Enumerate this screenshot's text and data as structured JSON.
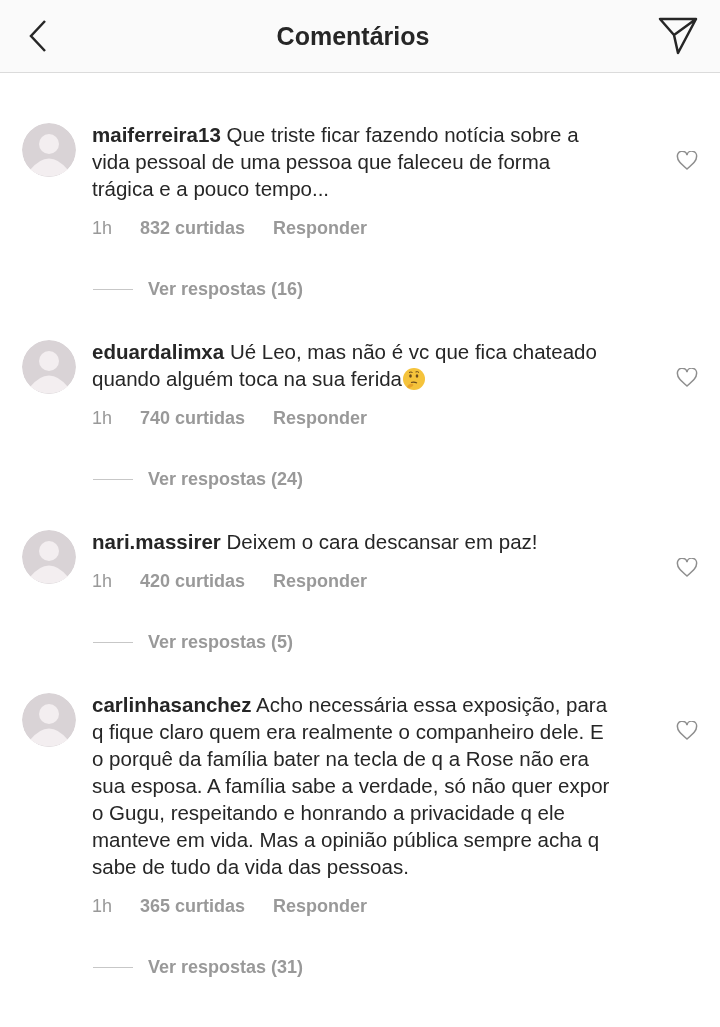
{
  "header": {
    "title": "Comentários"
  },
  "comments": [
    {
      "user": "maiferreira13",
      "text": "Que triste ficar fazendo notícia sobre a vida pessoal de uma pessoa que faleceu de forma trágica e a pouco tempo...",
      "time": "1h",
      "likes": "832 curtidas",
      "reply": "Responder",
      "replies": "Ver respostas (16)"
    },
    {
      "user": "eduardalimxa",
      "text": "Ué Leo, mas não é vc que fica chateado quando alguém toca na sua ferida",
      "thinking_emoji": true,
      "time": "1h",
      "likes": "740 curtidas",
      "reply": "Responder",
      "replies": "Ver respostas (24)"
    },
    {
      "user": "nari.massirer",
      "text": "Deixem o cara descansar em paz!",
      "time": "1h",
      "likes": "420 curtidas",
      "reply": "Responder",
      "replies": "Ver respostas (5)"
    },
    {
      "user": "carlinhasanchez",
      "text": "Acho necessária essa exposição, para q fique claro quem era realmente o companheiro dele. E o porquê da família bater na tecla de q a Rose não era sua esposa. A família sabe a verdade, só não quer expor o Gugu, respeitando e honrando a privacidade q ele manteve em vida. Mas a opinião pública sempre acha q sabe de tudo da vida das pessoas.",
      "time": "1h",
      "likes": "365 curtidas",
      "reply": "Responder",
      "replies": "Ver respostas (31)"
    }
  ]
}
